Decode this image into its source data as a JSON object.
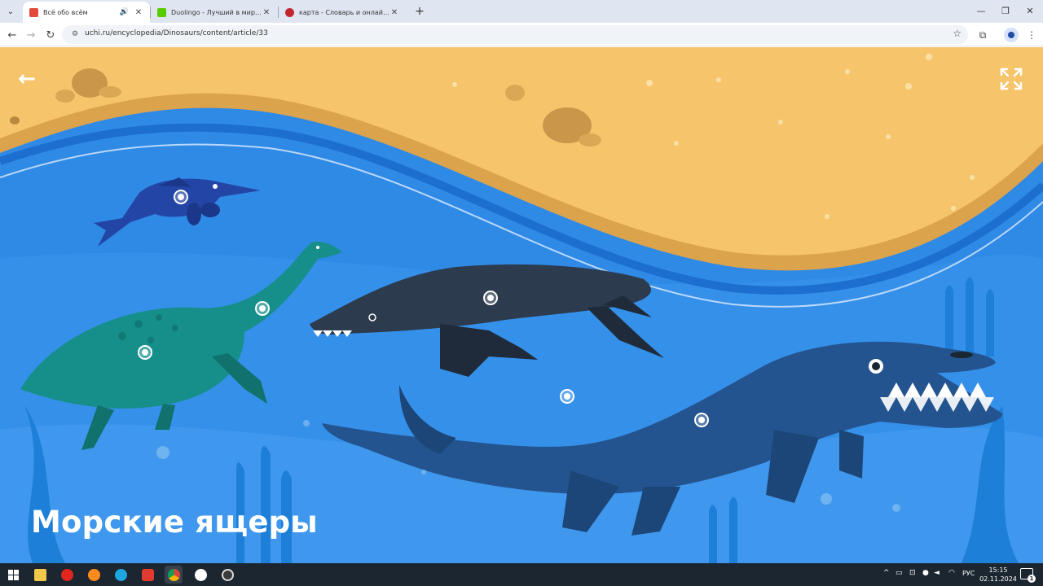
{
  "tabs": [
    {
      "title": "Всё обо всём",
      "favicon_color": "#e24a3b",
      "active": true,
      "audio": true
    },
    {
      "title": "Duolingo - Лучший в мире спо",
      "favicon_color": "#58cc02",
      "active": false,
      "audio": false
    },
    {
      "title": "карта - Словарь и онлайн пер",
      "favicon_color": "#c2262e",
      "active": false,
      "audio": false
    }
  ],
  "address": {
    "url": "uchi.ru/encyclopedia/Dinosaurs/content/article/33"
  },
  "page": {
    "title": "Морские ящеры",
    "colors": {
      "sand": "#f6c56b",
      "sand_edge": "#dca34d",
      "water": "#2f8ae6",
      "water_dark": "#1c6ecf"
    }
  },
  "taskbar": {
    "time": "15:15",
    "date": "02.11.2024",
    "language": "РУС",
    "notifications": "1"
  }
}
